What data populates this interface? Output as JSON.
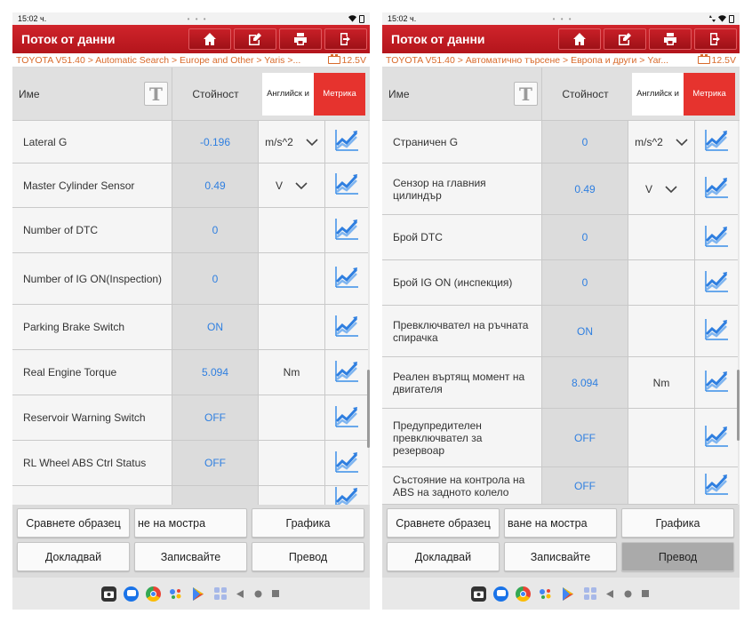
{
  "status_left": {
    "time": "15:02 ч.",
    "dots": "• • •"
  },
  "status_right": {
    "time": "15:02 ч.",
    "dots": "• • •"
  },
  "colors": {
    "accent": "#c81f27",
    "value_blue": "#2f7fe0",
    "breadcrumb": "#d86a2b",
    "metric_active": "#e6332e"
  },
  "left": {
    "title": "Поток от данни",
    "breadcrumb": "TOYOTA V51.40 > Automatic Search > Europe and Other > Yaris >...",
    "voltage": "12.5V",
    "header": {
      "name": "Име",
      "value": "Стойност",
      "english": "Английск и",
      "metric": "Метрика",
      "t_icon": "T"
    },
    "rows": [
      {
        "name": "Lateral G",
        "value": "-0.196",
        "unit": "m/s^2",
        "dropdown": true,
        "h": 48
      },
      {
        "name": "Master Cylinder Sensor",
        "value": "0.49",
        "unit": "V",
        "dropdown": true,
        "h": 50
      },
      {
        "name": "Number of DTC",
        "value": "0",
        "unit": "",
        "dropdown": false,
        "h": 51
      },
      {
        "name": "Number of IG ON(Inspection)",
        "value": "0",
        "unit": "",
        "dropdown": false,
        "h": 58
      },
      {
        "name": "Parking Brake Switch",
        "value": "ON",
        "unit": "",
        "dropdown": false,
        "h": 51
      },
      {
        "name": "Real Engine Torque",
        "value": "5.094",
        "unit": "Nm",
        "dropdown": false,
        "h": 51
      },
      {
        "name": "Reservoir Warning Switch",
        "value": "OFF",
        "unit": "",
        "dropdown": false,
        "h": 51
      },
      {
        "name": "RL Wheel ABS Ctrl Status",
        "value": "OFF",
        "unit": "",
        "dropdown": false,
        "h": 51
      },
      {
        "name": "",
        "value": "",
        "unit": "",
        "dropdown": false,
        "h": 30
      }
    ],
    "buttons": [
      "Сравнете образец",
      "не на мостра",
      "Графика",
      "Докладвай",
      "Записвайте",
      "Превод"
    ]
  },
  "right": {
    "title": "Поток от данни",
    "breadcrumb": "TOYOTA V51.40 > Автоматично търсене > Европа и други > Yar...",
    "voltage": "12.5V",
    "header": {
      "name": "Име",
      "value": "Стойност",
      "english": "Английск и",
      "metric": "Метрика",
      "t_icon": "T"
    },
    "rows": [
      {
        "name": "Страничен G",
        "value": "0",
        "unit": "m/s^2",
        "dropdown": true,
        "h": 48
      },
      {
        "name": "Сензор на главния цилиндър",
        "value": "0.49",
        "unit": "V",
        "dropdown": true,
        "h": 58
      },
      {
        "name": "Брой DTC",
        "value": "0",
        "unit": "",
        "dropdown": false,
        "h": 51
      },
      {
        "name": "Брой IG ON (инспекция)",
        "value": "0",
        "unit": "",
        "dropdown": false,
        "h": 51
      },
      {
        "name": "Превключвател на ръчната спирачка",
        "value": "ON",
        "unit": "",
        "dropdown": false,
        "h": 58
      },
      {
        "name": "Реален въртящ момент на двигателя",
        "value": "8.094",
        "unit": "Nm",
        "dropdown": false,
        "h": 58
      },
      {
        "name": "Предупредителен превключвател за резервоар",
        "value": "OFF",
        "unit": "",
        "dropdown": false,
        "h": 66
      },
      {
        "name": "Състояние на контрола на ABS на задното колело",
        "value": "OFF",
        "unit": "",
        "dropdown": false,
        "h": 42
      }
    ],
    "buttons": [
      "Сравнете образец",
      "ване на мостра",
      "Графика",
      "Докладвай",
      "Записвайте",
      "Превод"
    ]
  },
  "nav_icons": [
    "camera-app-icon",
    "messages-app-icon",
    "chrome-app-icon",
    "assistant-app-icon",
    "play-store-app-icon",
    "app-drawer-icon",
    "back-nav-icon",
    "home-nav-icon",
    "recents-nav-icon"
  ]
}
